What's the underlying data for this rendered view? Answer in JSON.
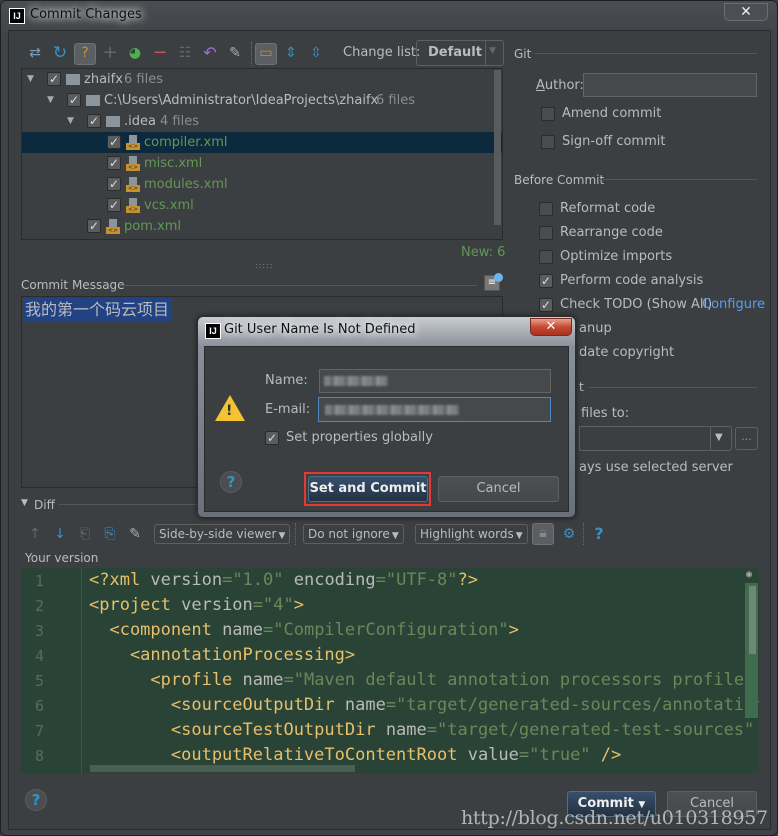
{
  "window": {
    "title": "Commit Changes",
    "app_icon": "IJ",
    "close_glyph": "✕"
  },
  "toolbar": {
    "icons": [
      "show-diff-icon",
      "refresh-icon",
      "unversioned-files-icon",
      "add-icon",
      "move-to-changelist-icon",
      "remove-icon",
      "select-all-icon",
      "revert-icon",
      "edit-source-icon",
      "group-by-directory-icon",
      "expand-all-icon",
      "collapse-all-icon"
    ],
    "changelist_label": "Change list:",
    "changelist_value": "Default"
  },
  "tree": {
    "items": [
      {
        "name": "zhaifx",
        "count": "6 files",
        "level": 0,
        "type": "module",
        "checked": true,
        "expanded": true
      },
      {
        "name": "C:\\Users\\Administrator\\IdeaProjects\\zhaifx",
        "count": "6 files",
        "level": 1,
        "type": "folder",
        "checked": true,
        "expanded": true
      },
      {
        "name": ".idea",
        "count": "4 files",
        "level": 2,
        "type": "folder",
        "checked": true,
        "expanded": true
      },
      {
        "name": "compiler.xml",
        "level": 3,
        "type": "xml",
        "checked": true,
        "selected": true
      },
      {
        "name": "misc.xml",
        "level": 3,
        "type": "xml",
        "checked": true
      },
      {
        "name": "modules.xml",
        "level": 3,
        "type": "xml",
        "checked": true
      },
      {
        "name": "vcs.xml",
        "level": 3,
        "type": "xml",
        "checked": true
      },
      {
        "name": "pom.xml",
        "level": 2,
        "type": "xml",
        "checked": true
      }
    ],
    "status": "New: 6"
  },
  "commit_message": {
    "label": "Commit Message",
    "value": "我的第一个码云项目"
  },
  "git": {
    "section": "Git",
    "author_label": "Author:",
    "author_value": "",
    "amend_label": "Amend commit",
    "amend_checked": false,
    "signoff_label": "Sign-off commit",
    "signoff_checked": false
  },
  "before_commit": {
    "section": "Before Commit",
    "options": [
      {
        "label": "Reformat code",
        "checked": false
      },
      {
        "label": "Rearrange code",
        "checked": false
      },
      {
        "label": "Optimize imports",
        "checked": false
      },
      {
        "label": "Perform code analysis",
        "checked": true
      },
      {
        "label": "Check TODO (Show All)",
        "checked": true,
        "link": "Configure"
      },
      {
        "label": "Cleanup",
        "visible": "anup"
      },
      {
        "label": "Update copyright",
        "visible": "date copyright"
      }
    ],
    "after_section_partial": "t",
    "upload_label_partial": "files to:",
    "server_combo_value": "",
    "browse_label": "...",
    "always_use_partial": "ays use selected server"
  },
  "diff": {
    "section": "Diff",
    "viewer_combo": "Side-by-side viewer",
    "ignore_combo": "Do not ignore",
    "highlight_combo": "Highlight words",
    "your_version_label": "Your version",
    "lines": [
      {
        "n": "1",
        "parts": [
          [
            "tag",
            "<?xml "
          ],
          [
            "attr",
            "version"
          ],
          [
            "str",
            "=\"1.0\" "
          ],
          [
            "attr",
            "encoding"
          ],
          [
            "str",
            "=\"UTF-8\""
          ],
          [
            "tag",
            "?>"
          ]
        ]
      },
      {
        "n": "2",
        "parts": [
          [
            "tag",
            "<project "
          ],
          [
            "attr",
            "version"
          ],
          [
            "str",
            "=\"4\""
          ],
          [
            "tag",
            ">"
          ]
        ]
      },
      {
        "n": "3",
        "parts": [
          [
            "tag",
            "  <component "
          ],
          [
            "attr",
            "name"
          ],
          [
            "str",
            "=\"CompilerConfiguration\""
          ],
          [
            "tag",
            ">"
          ]
        ]
      },
      {
        "n": "4",
        "parts": [
          [
            "tag",
            "    <annotationProcessing>"
          ]
        ]
      },
      {
        "n": "5",
        "parts": [
          [
            "tag",
            "      <profile "
          ],
          [
            "attr",
            "name"
          ],
          [
            "str",
            "=\"Maven default annotation processors profile\""
          ]
        ]
      },
      {
        "n": "6",
        "parts": [
          [
            "tag",
            "        <sourceOutputDir "
          ],
          [
            "attr",
            "name"
          ],
          [
            "str",
            "=\"target/generated-sources/annotations\""
          ]
        ]
      },
      {
        "n": "7",
        "parts": [
          [
            "tag",
            "        <sourceTestOutputDir "
          ],
          [
            "attr",
            "name"
          ],
          [
            "str",
            "=\"target/generated-test-sources\""
          ]
        ]
      },
      {
        "n": "8",
        "parts": [
          [
            "tag",
            "        <outputRelativeToContentRoot "
          ],
          [
            "attr",
            "value"
          ],
          [
            "str",
            "=\"true\" "
          ],
          [
            "tag",
            "/>"
          ]
        ]
      }
    ]
  },
  "footer": {
    "commit_label": "Commit",
    "cancel_label": "Cancel",
    "help_glyph": "?"
  },
  "dialog": {
    "title": "Git User Name Is Not Defined",
    "name_label": "Name:",
    "name_value": "(redacted)",
    "email_label": "E-mail:",
    "email_value": "(redacted)",
    "set_globally_label": "Set properties globally",
    "set_globally_checked": true,
    "set_and_commit_label": "Set and Commit",
    "cancel_label": "Cancel",
    "help_glyph": "?",
    "warning_glyph": "!"
  },
  "watermark": "http://blog.csdn.net/u010318957",
  "colors": {
    "bg": "#3c3f41",
    "selection": "#0d293e",
    "new_file": "#629755",
    "link": "#589df6",
    "editor_bg": "#294436",
    "highlight_box": "#e53935"
  }
}
